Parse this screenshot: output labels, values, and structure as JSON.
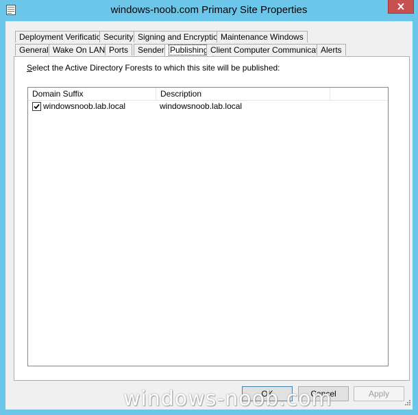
{
  "window": {
    "title": "windows-noob.com Primary Site Properties"
  },
  "tabs": {
    "row1": [
      {
        "label": "Deployment Verification"
      },
      {
        "label": "Security"
      },
      {
        "label": "Signing and Encryption"
      },
      {
        "label": "Maintenance Windows"
      }
    ],
    "row2": [
      {
        "label": "General"
      },
      {
        "label": "Wake On LAN"
      },
      {
        "label": "Ports"
      },
      {
        "label": "Sender"
      },
      {
        "label": "Publishing"
      },
      {
        "label": "Client Computer Communication"
      },
      {
        "label": "Alerts"
      }
    ],
    "active": "Publishing"
  },
  "panel": {
    "instruction_prefix": "S",
    "instruction_rest": "elect the Active Directory Forests to which this site will be published:",
    "list": {
      "columns": [
        "Domain Suffix",
        "Description"
      ],
      "rows": [
        {
          "checked": true,
          "domain_suffix": "windowsnoob.lab.local",
          "description": "windowsnoob.lab.local"
        }
      ]
    }
  },
  "buttons": {
    "ok": "OK",
    "cancel": "Cancel",
    "apply": "Apply"
  },
  "watermark": "windows-noob.com",
  "colors": {
    "titlebar": "#6cc6ea",
    "close": "#c75050",
    "face": "#f0f0f0"
  }
}
